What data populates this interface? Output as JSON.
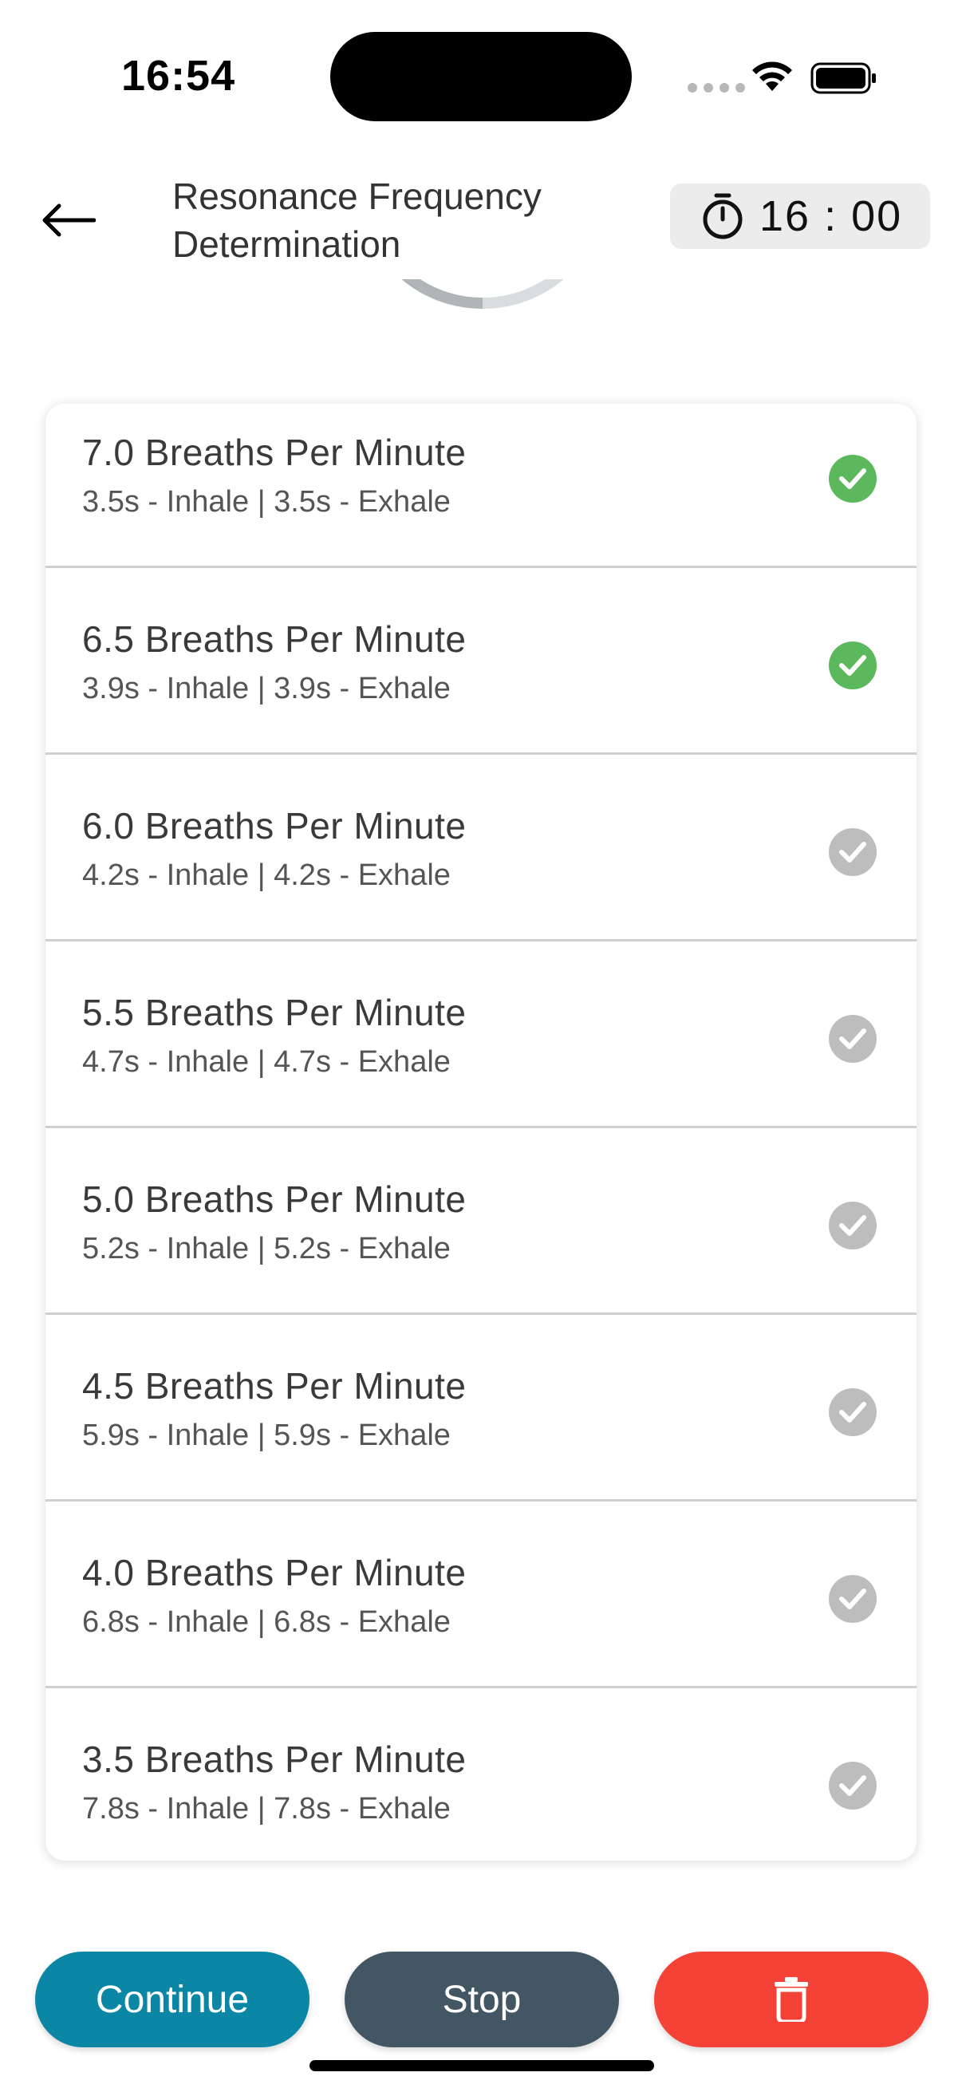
{
  "status_bar": {
    "time": "16:54"
  },
  "header": {
    "title_line1": "Resonance Frequency",
    "title_line2": "Determination",
    "timer": "16 : 00"
  },
  "colors": {
    "completed": "#5cb85c",
    "pending": "#bdbdbd",
    "continue": "#0b87a5",
    "stop": "#425763",
    "delete": "#f44336"
  },
  "rates": [
    {
      "title": "7.0 Breaths Per Minute",
      "subtitle": "3.5s - Inhale | 3.5s - Exhale",
      "status": "completed"
    },
    {
      "title": "6.5 Breaths Per Minute",
      "subtitle": "3.9s - Inhale | 3.9s - Exhale",
      "status": "completed"
    },
    {
      "title": "6.0 Breaths Per Minute",
      "subtitle": "4.2s - Inhale | 4.2s - Exhale",
      "status": "pending"
    },
    {
      "title": "5.5 Breaths Per Minute",
      "subtitle": "4.7s - Inhale | 4.7s - Exhale",
      "status": "pending"
    },
    {
      "title": "5.0 Breaths Per Minute",
      "subtitle": "5.2s - Inhale | 5.2s - Exhale",
      "status": "pending"
    },
    {
      "title": "4.5 Breaths Per Minute",
      "subtitle": "5.9s - Inhale | 5.9s - Exhale",
      "status": "pending"
    },
    {
      "title": "4.0 Breaths Per Minute",
      "subtitle": "6.8s - Inhale | 6.8s - Exhale",
      "status": "pending"
    },
    {
      "title": "3.5 Breaths Per Minute",
      "subtitle": "7.8s - Inhale | 7.8s - Exhale",
      "status": "pending"
    }
  ],
  "buttons": {
    "continue_label": "Continue",
    "stop_label": "Stop",
    "delete_icon": "trash-icon"
  }
}
